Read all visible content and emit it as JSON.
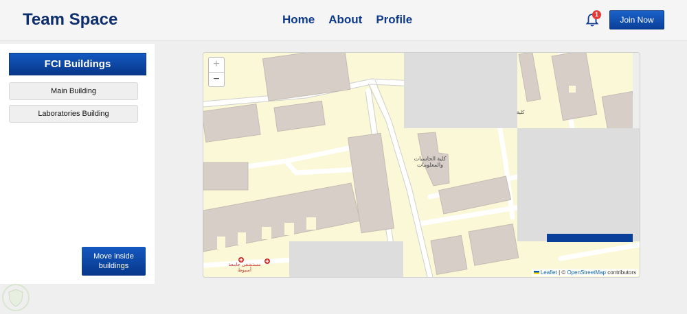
{
  "header": {
    "brand": "Team Space",
    "nav": [
      "Home",
      "About",
      "Profile"
    ],
    "notification_count": "1",
    "join_label": "Join Now"
  },
  "sidebar": {
    "title": "FCI Buildings",
    "items": [
      "Main Building",
      "Laboratories Building"
    ],
    "move_label": "Move inside buildings"
  },
  "map": {
    "zoom_in": "+",
    "zoom_out": "−",
    "attribution": {
      "leaflet": "Leaflet",
      "separator": " | © ",
      "osm": "OpenStreetMap",
      "suffix": " contributors"
    },
    "labels": {
      "faculty": "كلية الحاسبات والمعلومات",
      "faculty_partial": "كلية",
      "hospital": "مستشفى جامعة أسيوط"
    }
  },
  "colors": {
    "brand": "#0d2f6d",
    "accent": "#0a3f99",
    "land": "#fbf8d8",
    "building": "#d7cfc7",
    "tile_missing": "#dddddd"
  }
}
